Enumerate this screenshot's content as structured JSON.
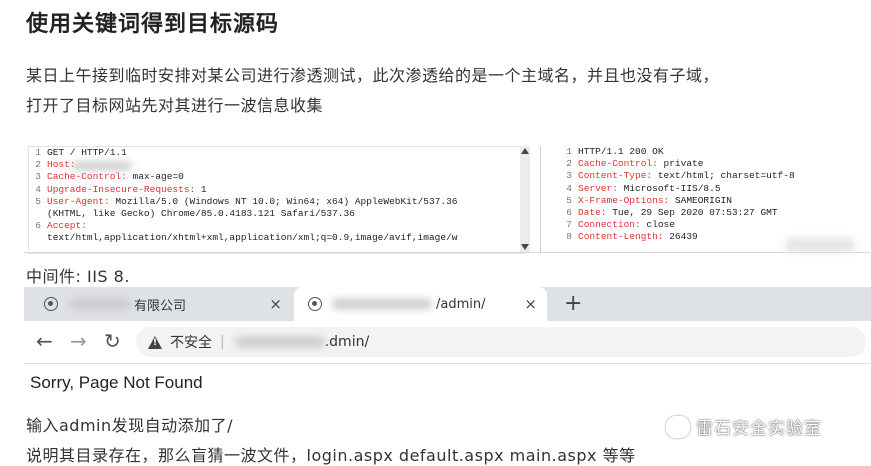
{
  "article": {
    "title": "使用关键词得到目标源码",
    "intro_line1": "某日上午接到临时安排对某公司进行渗透测试，此次渗透给的是一个主域名，并且也没有子域，",
    "intro_line2": "打开了目标网站先对其进行一波信息收集",
    "middleware_line": "中间件: IIS 8.",
    "admin_line": "输入admin发现自动添加了/",
    "conclusion_line": "说明其目录存在，那么盲猜一波文件，login.aspx default.aspx main.aspx 等等"
  },
  "request": {
    "lines": [
      {
        "no": "1",
        "key": "",
        "val": "GET / HTTP/1.1"
      },
      {
        "no": "2",
        "key": "Host:",
        "val": ""
      },
      {
        "no": "3",
        "key": "Cache-Control:",
        "val": " max-age=0"
      },
      {
        "no": "4",
        "key": "Upgrade-Insecure-Requests:",
        "val": " 1"
      },
      {
        "no": "5",
        "key": "User-Agent:",
        "val": " Mozilla/5.0 (Windows NT 10.0; Win64; x64) AppleWebKit/537.36"
      },
      {
        "no": "",
        "key": "",
        "val": "(KHTML, like Gecko) Chrome/85.0.4183.121 Safari/537.36"
      },
      {
        "no": "6",
        "key": "Accept:",
        "val": ""
      },
      {
        "no": "",
        "key": "",
        "val": "text/html,application/xhtml+xml,application/xml;q=0.9,image/avif,image/w"
      }
    ]
  },
  "response": {
    "lines": [
      {
        "no": "1",
        "key": "",
        "val": "HTTP/1.1 200 OK"
      },
      {
        "no": "2",
        "key": "Cache-Control:",
        "val": " private"
      },
      {
        "no": "3",
        "key": "Content-Type:",
        "val": " text/html; charset=utf-8"
      },
      {
        "no": "4",
        "key": "Server:",
        "val": " Microsoft-IIS/8.5"
      },
      {
        "no": "5",
        "key": "X-Frame-Options:",
        "val": " SAMEORIGIN"
      },
      {
        "no": "6",
        "key": "Date:",
        "val": " Tue, 29 Sep 2020 07:53:27 GMT"
      },
      {
        "no": "7",
        "key": "Connection:",
        "val": " close"
      },
      {
        "no": "8",
        "key": "Content-Length:",
        "val": " 26439"
      }
    ]
  },
  "browser": {
    "tab1_title": "有限公司",
    "tab2_title": "/admin/",
    "tab_close": "×",
    "new_tab": "+",
    "security_label": "不安全",
    "url_suffix": ".dmin/",
    "page_message": "Sorry, Page Not Found"
  },
  "watermark": {
    "text": "雷石安全实验室"
  },
  "colors": {
    "header_key": "#d33333",
    "tab_bar": "#dee1e6",
    "omnibox": "#f1f3f4"
  }
}
